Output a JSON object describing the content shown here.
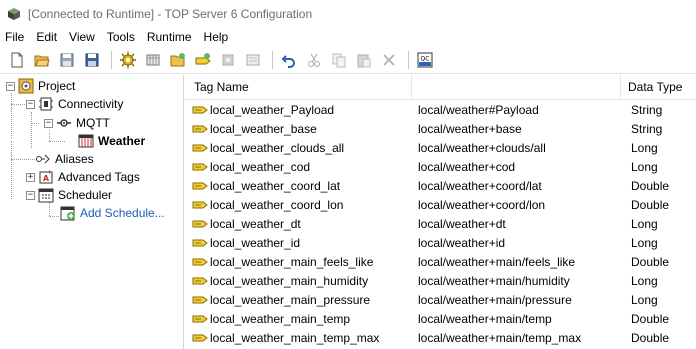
{
  "window": {
    "title": "[Connected to Runtime] - TOP Server 6 Configuration"
  },
  "menu": [
    "File",
    "Edit",
    "View",
    "Tools",
    "Runtime",
    "Help"
  ],
  "toolbar": {
    "buttons": [
      "new-file-icon",
      "open-folder-icon",
      "save-icon",
      "save-as-icon",
      "new-channel-icon",
      "new-device-icon",
      "new-tag-group-icon",
      "new-tag-icon",
      "bulk-tag-icon",
      "properties-icon",
      "undo-icon",
      "cut-icon",
      "copy-icon",
      "paste-icon",
      "delete-icon",
      "quick-client-icon"
    ],
    "quick_client_label": "QC"
  },
  "tree": {
    "project": "Project",
    "connectivity": "Connectivity",
    "mqtt": "MQTT",
    "weather": "Weather",
    "aliases": "Aliases",
    "advanced_tags": "Advanced Tags",
    "scheduler": "Scheduler",
    "add_schedule": "Add Schedule...",
    "expander_open": "−",
    "expander_closed": "+"
  },
  "grid": {
    "headers": {
      "name": "Tag Name",
      "address": "",
      "type": "Data Type"
    },
    "rows": [
      {
        "name": "local_weather_Payload",
        "address": "local/weather#Payload",
        "type": "String"
      },
      {
        "name": "local_weather_base",
        "address": "local/weather+base",
        "type": "String"
      },
      {
        "name": "local_weather_clouds_all",
        "address": "local/weather+clouds/all",
        "type": "Long"
      },
      {
        "name": "local_weather_cod",
        "address": "local/weather+cod",
        "type": "Long"
      },
      {
        "name": "local_weather_coord_lat",
        "address": "local/weather+coord/lat",
        "type": "Double"
      },
      {
        "name": "local_weather_coord_lon",
        "address": "local/weather+coord/lon",
        "type": "Double"
      },
      {
        "name": "local_weather_dt",
        "address": "local/weather+dt",
        "type": "Long"
      },
      {
        "name": "local_weather_id",
        "address": "local/weather+id",
        "type": "Long"
      },
      {
        "name": "local_weather_main_feels_like",
        "address": "local/weather+main/feels_like",
        "type": "Double"
      },
      {
        "name": "local_weather_main_humidity",
        "address": "local/weather+main/humidity",
        "type": "Long"
      },
      {
        "name": "local_weather_main_pressure",
        "address": "local/weather+main/pressure",
        "type": "Long"
      },
      {
        "name": "local_weather_main_temp",
        "address": "local/weather+main/temp",
        "type": "Double"
      },
      {
        "name": "local_weather_main_temp_max",
        "address": "local/weather+main/temp_max",
        "type": "Double"
      }
    ]
  },
  "colors": {
    "tag_icon": "#e8c21a",
    "link": "#1a5fb4",
    "grid_line": "#e6e6e6"
  }
}
